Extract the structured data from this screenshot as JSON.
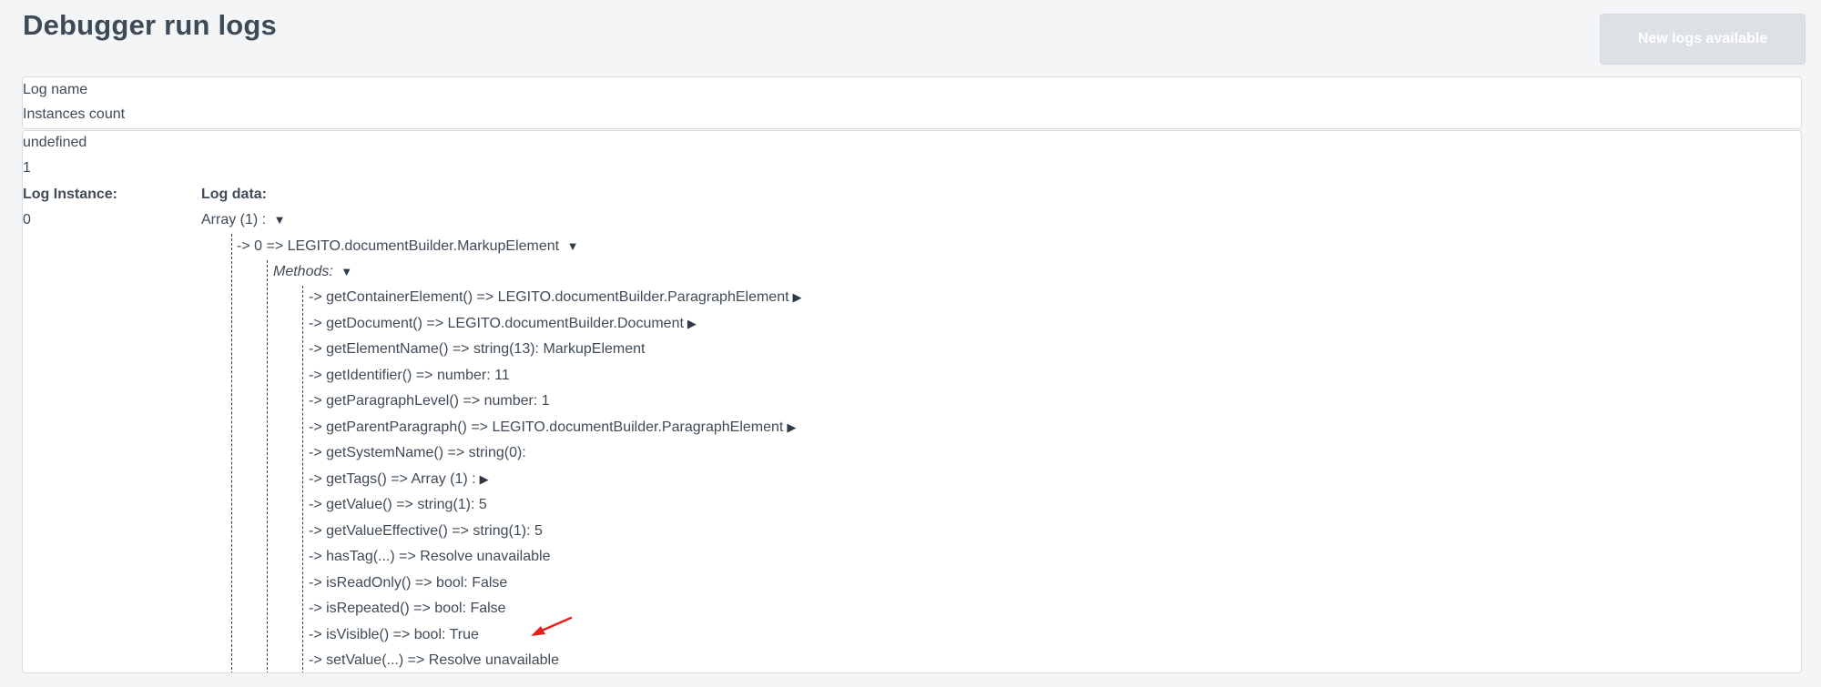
{
  "page": {
    "title": "Debugger run logs",
    "new_logs_button": "New logs available"
  },
  "header": {
    "log_name_label": "Log name",
    "instances_count_label": "Instances count"
  },
  "log": {
    "name": "undefined",
    "count": "1",
    "instance_label": "Log Instance:",
    "data_label": "Log data:",
    "instance_value": "0",
    "array_line": "Array (1) :",
    "element_line": "-> 0 => LEGITO.documentBuilder.MarkupElement",
    "methods_label": "Methods:",
    "methods": [
      {
        "text": "-> getContainerElement() => LEGITO.documentBuilder.ParagraphElement",
        "expander": "▶"
      },
      {
        "text": "-> getDocument() => LEGITO.documentBuilder.Document",
        "expander": "▶"
      },
      {
        "text": "-> getElementName() => string(13): MarkupElement",
        "expander": ""
      },
      {
        "text": "-> getIdentifier() => number: 11",
        "expander": ""
      },
      {
        "text": "-> getParagraphLevel() => number: 1",
        "expander": ""
      },
      {
        "text": "-> getParentParagraph() => LEGITO.documentBuilder.ParagraphElement",
        "expander": "▶"
      },
      {
        "text": "-> getSystemName() => string(0):",
        "expander": ""
      },
      {
        "text": "-> getTags() => Array (1) :",
        "expander": "▶"
      },
      {
        "text": "-> getValue() => string(1): 5",
        "expander": ""
      },
      {
        "text": "-> getValueEffective() => string(1): 5",
        "expander": ""
      },
      {
        "text": "-> hasTag(...) => Resolve unavailable",
        "expander": ""
      },
      {
        "text": "-> isReadOnly() => bool: False",
        "expander": ""
      },
      {
        "text": "-> isRepeated() => bool: False",
        "expander": ""
      },
      {
        "text": "-> isVisible() => bool: True",
        "expander": ""
      },
      {
        "text": "-> setValue(...) => Resolve unavailable",
        "expander": ""
      }
    ]
  },
  "expand_arrow": "▼",
  "collapse_arrow": "▶",
  "colors": {
    "annotation_arrow": "#e8201c",
    "button_disabled": "#dde1e5"
  }
}
